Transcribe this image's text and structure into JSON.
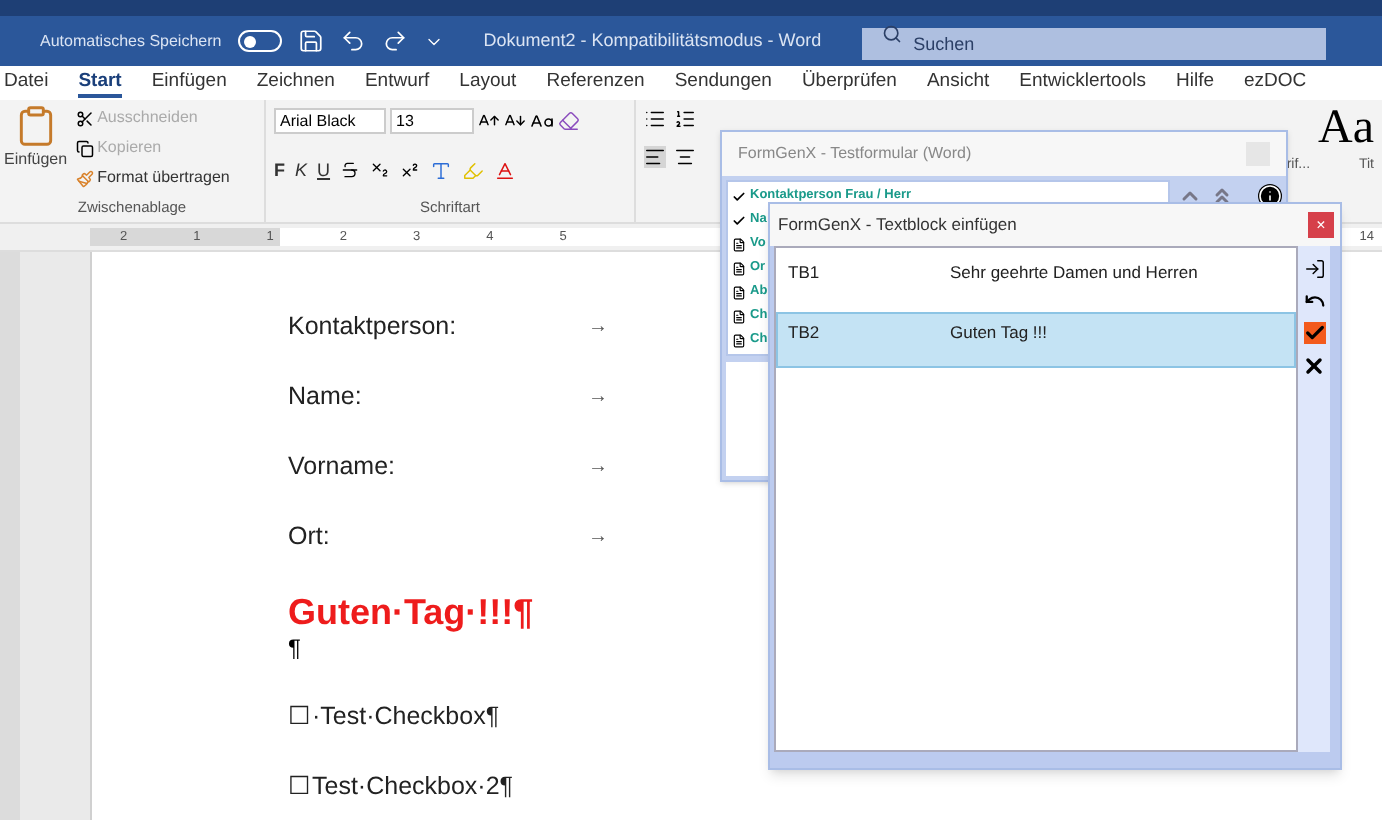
{
  "title_bar": {
    "autosave_label": "Automatisches Speichern",
    "autosave_on": false,
    "document_title": "Dokument2 - Kompatibilitätsmodus - Word",
    "search": {
      "placeholder": "Suchen"
    }
  },
  "menu_tabs": [
    {
      "label": "Datei",
      "selected": false
    },
    {
      "label": "Start",
      "selected": true
    },
    {
      "label": "Einfügen",
      "selected": false
    },
    {
      "label": "Zeichnen",
      "selected": false
    },
    {
      "label": "Entwurf",
      "selected": false
    },
    {
      "label": "Layout",
      "selected": false
    },
    {
      "label": "Referenzen",
      "selected": false
    },
    {
      "label": "Sendungen",
      "selected": false
    },
    {
      "label": "Überprüfen",
      "selected": false
    },
    {
      "label": "Ansicht",
      "selected": false
    },
    {
      "label": "Entwicklertools",
      "selected": false
    },
    {
      "label": "Hilfe",
      "selected": false
    },
    {
      "label": "ezDOC",
      "selected": false
    }
  ],
  "ribbon": {
    "clipboard": {
      "paste_label": "Einfügen",
      "actions": [
        {
          "label": "Ausschneiden",
          "disabled": true
        },
        {
          "label": "Kopieren",
          "disabled": true
        },
        {
          "label": "Format übertragen",
          "disabled": false
        }
      ],
      "group_label": "Zwischenablage"
    },
    "font": {
      "family": "Arial Black",
      "size": "13",
      "format_letters": [
        "F",
        "K",
        "U"
      ],
      "group_label": "Schriftart"
    },
    "styles": {
      "sample": "Aa",
      "labels": [
        "rif...",
        "Tit"
      ]
    }
  },
  "ruler": {
    "numbers": [
      "2",
      "1",
      "1",
      "2",
      "3",
      "4",
      "5"
    ],
    "right_number": "14"
  },
  "document": {
    "fields": [
      {
        "label": "Kontaktperson:",
        "tab": "→"
      },
      {
        "label": "Name:",
        "tab": "→"
      },
      {
        "label": "Vorname:",
        "tab": "→"
      },
      {
        "label": "Ort:",
        "tab": "→"
      }
    ],
    "heading": "Guten·Tag·!!!¶",
    "empty_paragraph": "¶",
    "checkbox_lines": [
      "☐·Test·Checkbox¶",
      "☐Test·Checkbox·2¶"
    ]
  },
  "form_dialog": {
    "title": "FormGenX - Testformular (Word)",
    "items": [
      {
        "label": "Kontaktperson Frau / Herr",
        "kind": "done"
      },
      {
        "label": "Na",
        "kind": "done"
      },
      {
        "label": "Vo",
        "kind": "doc"
      },
      {
        "label": "Or",
        "kind": "doc"
      },
      {
        "label": "Ab",
        "kind": "doc"
      },
      {
        "label": "Ch",
        "kind": "doc"
      },
      {
        "label": "Ch",
        "kind": "doc"
      }
    ]
  },
  "textblock_dialog": {
    "title": "FormGenX - Textblock einfügen",
    "close": "×",
    "rows": [
      {
        "code": "TB1",
        "text": "Sehr geehrte Damen und Herren",
        "selected": false
      },
      {
        "code": "TB2",
        "text": "Guten Tag !!!",
        "selected": true
      }
    ]
  }
}
